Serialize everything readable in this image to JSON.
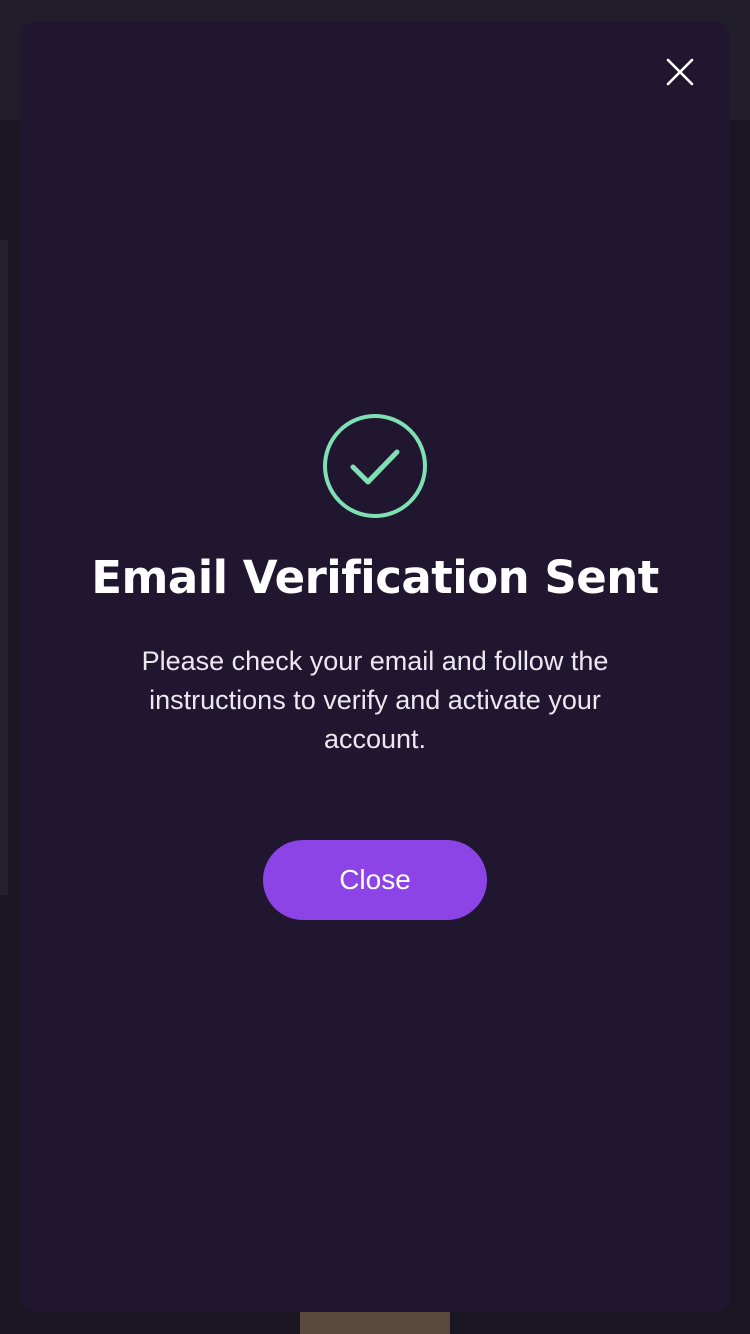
{
  "modal": {
    "close_icon": "close-icon",
    "status_icon": "check-circle-icon",
    "title": "Email Verification Sent",
    "message": "Please check your email and follow the instructions to verify and activate your account.",
    "close_button_label": "Close"
  },
  "colors": {
    "backdrop": "#1b1722",
    "modal_background": "#20162f",
    "success": "#7fe0b4",
    "primary_button": "#8c44e6",
    "text": "#ffffff"
  }
}
